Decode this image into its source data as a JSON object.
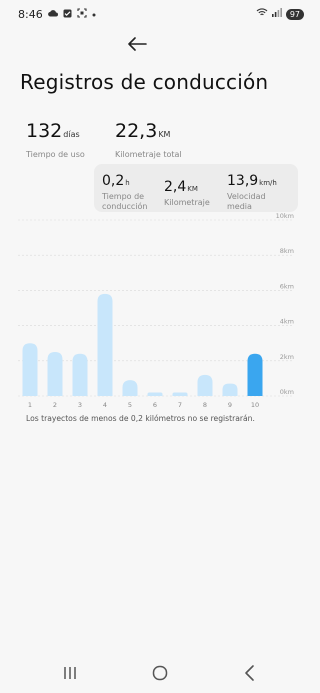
{
  "status": {
    "time": "8:46",
    "battery": "97",
    "left_icons": [
      "cloud-icon",
      "check-box-icon",
      "screenshot-icon",
      "dot-icon"
    ],
    "right_icons": [
      "wifi-icon",
      "signal-icon",
      "battery-icon"
    ]
  },
  "header": {
    "back_icon": "arrow-left-icon",
    "title": "Registros de conducción"
  },
  "stats": {
    "usage_days": {
      "value": "132",
      "unit": "días",
      "label": "Tiempo de uso"
    },
    "total_km": {
      "value": "22,3",
      "unit": "KM",
      "label": "Kilometraje total"
    }
  },
  "summary": {
    "time": {
      "value": "0,2",
      "unit": "h",
      "label": "Tiempo de conducción"
    },
    "distance": {
      "value": "2,4",
      "unit": "KM",
      "label": "Kilometraje"
    },
    "speed": {
      "value": "13,9",
      "unit": "km/h",
      "label": "Velocidad media"
    }
  },
  "chart_data": {
    "type": "bar",
    "categories": [
      "1",
      "2",
      "3",
      "4",
      "5",
      "6",
      "7",
      "8",
      "9",
      "10"
    ],
    "values": [
      3.0,
      2.5,
      2.4,
      5.8,
      0.9,
      0.2,
      0.2,
      1.2,
      0.7,
      2.4
    ],
    "highlight_index": 9,
    "y_ticks": [
      "0km",
      "2km",
      "4km",
      "6km",
      "8km",
      "10km"
    ],
    "ylim": [
      0,
      10
    ],
    "grid": true,
    "colors": {
      "bar": "#c8e6fb",
      "highlight": "#3aa6ef",
      "grid": "#d9d9d9"
    }
  },
  "note": "Los trayectos de menos de 0,2 kilómetros no se registrarán.",
  "navbar": {
    "icons": [
      "recent-apps-icon",
      "home-icon",
      "back-nav-icon"
    ]
  }
}
